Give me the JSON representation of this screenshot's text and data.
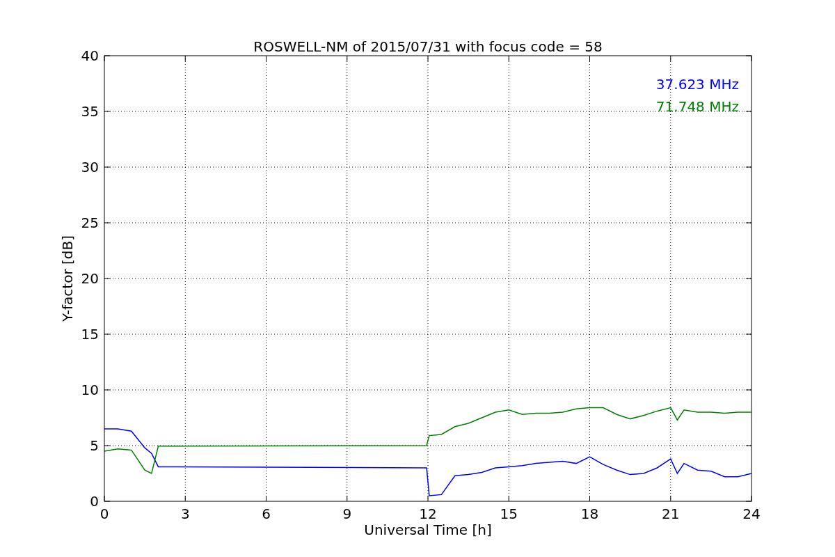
{
  "chart_data": {
    "type": "line",
    "title": "ROSWELL-NM of 2015/07/31 with focus code = 58",
    "xlabel": "Universal Time [h]",
    "ylabel": "Y-factor [dB]",
    "x": [
      0,
      0.5,
      1,
      1.5,
      1.75,
      2,
      11.95,
      12.05,
      12.5,
      13,
      13.5,
      14,
      14.5,
      15,
      15.5,
      16,
      16.5,
      17,
      17.5,
      18,
      18.5,
      19,
      19.5,
      20,
      20.5,
      21,
      21.25,
      21.5,
      22,
      22.5,
      23,
      23.5,
      24
    ],
    "series": [
      {
        "name": "37.623 MHz",
        "color": "#0000ff",
        "values": [
          6.5,
          6.5,
          6.3,
          4.8,
          4.3,
          3.1,
          3.0,
          0.5,
          0.6,
          2.3,
          2.4,
          2.6,
          3.0,
          3.1,
          3.2,
          3.4,
          3.5,
          3.6,
          3.4,
          4.0,
          3.3,
          2.8,
          2.4,
          2.5,
          3.0,
          3.8,
          2.5,
          3.4,
          2.8,
          2.7,
          2.2,
          2.2,
          2.5
        ]
      },
      {
        "name": "71.748 MHz",
        "color": "#008000",
        "values": [
          4.5,
          4.7,
          4.6,
          2.8,
          2.5,
          4.95,
          5.0,
          5.9,
          6.0,
          6.7,
          7.0,
          7.5,
          8.0,
          8.2,
          7.8,
          7.9,
          7.9,
          8.0,
          8.3,
          8.4,
          8.4,
          7.8,
          7.4,
          7.7,
          8.1,
          8.4,
          7.3,
          8.2,
          8.0,
          8.0,
          7.9,
          8.0,
          8.0
        ]
      }
    ],
    "grid": true,
    "xlim": [
      0,
      24
    ],
    "ylim": [
      0,
      40
    ],
    "xticks": [
      0,
      3,
      6,
      9,
      12,
      15,
      18,
      21,
      24
    ],
    "yticks": [
      0,
      5,
      10,
      15,
      20,
      25,
      30,
      35,
      40
    ]
  }
}
